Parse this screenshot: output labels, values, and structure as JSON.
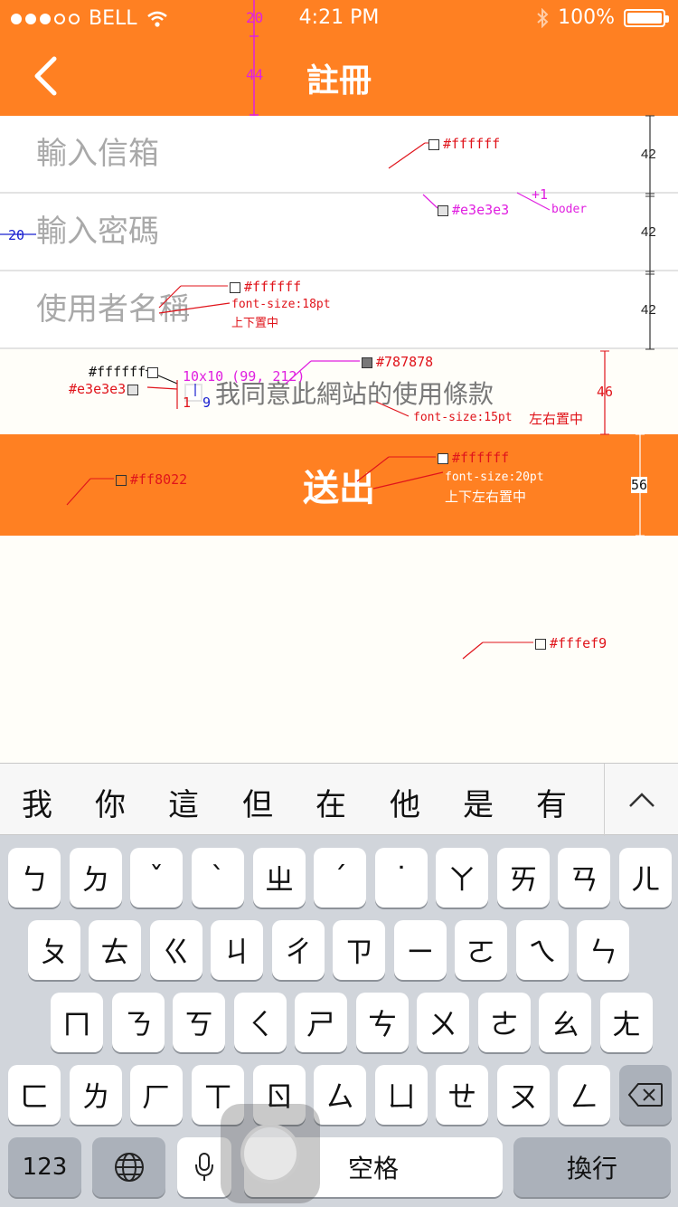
{
  "status": {
    "carrier": "BELL",
    "time": "4:21 PM",
    "battery": "100%"
  },
  "nav": {
    "title": "註冊",
    "back_icon": "chevron-left-icon"
  },
  "form": {
    "email_placeholder": "輸入信箱",
    "password_placeholder": "輸入密碼",
    "username_placeholder": "使用者名稱",
    "agree_text": "我同意此網站的使用條款",
    "submit_label": "送出"
  },
  "annotations": {
    "status_h": "20",
    "nav_h": "44",
    "field_bg": "#ffffff",
    "border_color": "#e3e3e3",
    "border_w": "+1",
    "border_label": "boder",
    "row1_h": "42",
    "row2_h": "42",
    "row3_h": "42",
    "indent": "20",
    "font_color": "#ffffff",
    "font_size": "font-size:18pt",
    "font_align": "上下置中",
    "cb_bg": "#ffffff",
    "cb_border": "#e3e3e3",
    "cb_size": "10x10 (99, 212)",
    "cb_gap1": "1",
    "cb_gap2": "9",
    "agree_color": "#787878",
    "agree_size": "font-size:15pt",
    "agree_align": "左右置中",
    "agree_h": "46",
    "btn_color": "#ff8022",
    "btn_text_color": "#ffffff",
    "btn_font": "font-size:20pt",
    "btn_align": "上下左右置中",
    "btn_h": "56",
    "page_bg": "#fffef9"
  },
  "keyboard": {
    "suggestions": [
      "我",
      "你",
      "這",
      "但",
      "在",
      "他",
      "是",
      "有"
    ],
    "row1": [
      "ㄅ",
      "ㄉ",
      "ˇ",
      "ˋ",
      "ㄓ",
      "ˊ",
      "˙",
      "ㄚ",
      "ㄞ",
      "ㄢ",
      "ㄦ"
    ],
    "row2": [
      "ㄆ",
      "ㄊ",
      "ㄍ",
      "ㄐ",
      "ㄔ",
      "ㄗ",
      "ㄧ",
      "ㄛ",
      "ㄟ",
      "ㄣ"
    ],
    "row3": [
      "ㄇ",
      "ㄋ",
      "ㄎ",
      "ㄑ",
      "ㄕ",
      "ㄘ",
      "ㄨ",
      "ㄜ",
      "ㄠ",
      "ㄤ"
    ],
    "row4": [
      "ㄈ",
      "ㄌ",
      "ㄏ",
      "ㄒ",
      "ㄖ",
      "ㄙ",
      "ㄩ",
      "ㄝ",
      "ㄡ",
      "ㄥ"
    ],
    "numbers_label": "123",
    "space_label": "空格",
    "return_label": "換行"
  },
  "colors": {
    "brand": "#ff8022",
    "page_bg": "#fffef9",
    "border": "#e3e3e3",
    "agree_text": "#787878"
  }
}
